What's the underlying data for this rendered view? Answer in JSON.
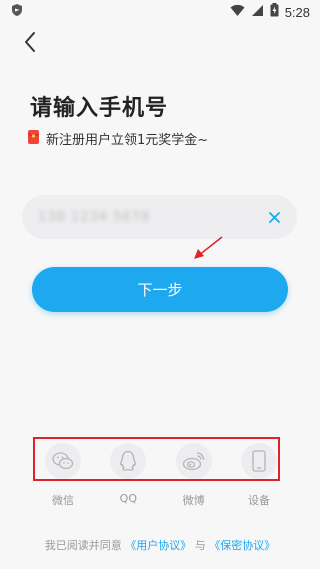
{
  "status_bar": {
    "time": "5:28"
  },
  "header": {
    "title": "请输入手机号",
    "promo_text": "新注册用户立领1元奖学金~"
  },
  "phone_input": {
    "value": "138 1234 5678"
  },
  "actions": {
    "next_label": "下一步"
  },
  "social_login": [
    {
      "label": "微信",
      "icon": "wechat-icon"
    },
    {
      "label": "QQ",
      "icon": "qq-icon"
    },
    {
      "label": "微博",
      "icon": "weibo-icon"
    },
    {
      "label": "设备",
      "icon": "device-icon"
    }
  ],
  "agreement": {
    "prefix": "我已阅读并同意",
    "user_agreement": "《用户协议》",
    "conjunction": "与",
    "privacy_agreement": "《保密协议》"
  },
  "colors": {
    "accent": "#1ea8ef",
    "highlight": "#d9252b",
    "promo_icon": "#f0443a"
  }
}
